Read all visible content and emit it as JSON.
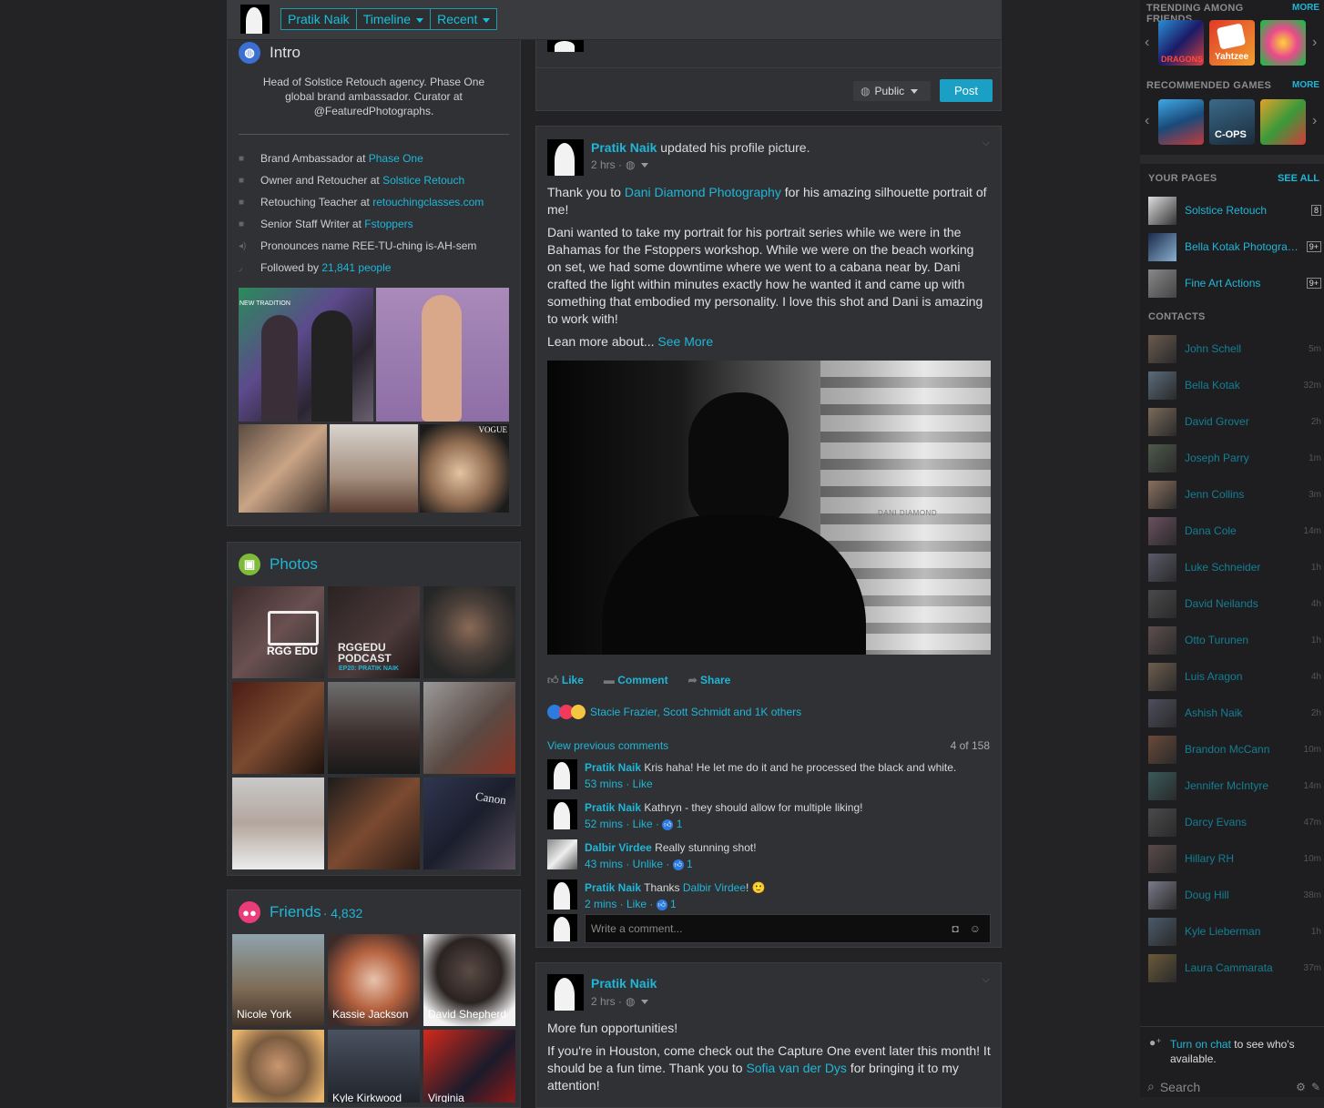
{
  "topbar": {
    "crumb_name": "Pratik Naik",
    "crumb_timeline": "Timeline",
    "crumb_recent": "Recent"
  },
  "intro": {
    "title": "Intro",
    "bio": "Head of Solstice Retouch agency. Phase One global brand ambassador. Curator at @FeaturedPhotographs.",
    "items": [
      {
        "text": "Brand Ambassador at ",
        "link": "Phase One"
      },
      {
        "text": "Owner and Retoucher at ",
        "link": "Solstice Retouch"
      },
      {
        "text": "Retouching Teacher at ",
        "link": "retouchingclasses.com"
      },
      {
        "text": "Senior Staff Writer at ",
        "link": "Fstoppers"
      },
      {
        "text": "Pronounces name REE-TU-ching is-AH-sem",
        "link": ""
      },
      {
        "text": "Followed by ",
        "link": "21,841 people"
      }
    ],
    "featured_label_1": "NEW TRADITION",
    "featured_label_2": "VOGUE"
  },
  "photos": {
    "title": "Photos",
    "tile1_text": "RGG EDU",
    "tile2_line1": "RGGEDU",
    "tile2_line2": "PODCAST",
    "tile2_line3": "EP20: PRATIK NAIK",
    "tile9_text": "Canon"
  },
  "friends": {
    "title": "Friends",
    "count": "· 4,832",
    "list": [
      "Nicole York",
      "Kassie Jackson",
      "David Shepherd",
      "",
      "Kyle Kirkwood",
      "Virginia"
    ]
  },
  "composer": {
    "privacy": "Public",
    "post_label": "Post"
  },
  "post1": {
    "author": "Pratik Naik",
    "action": " updated his profile picture.",
    "time": "2 hrs ·",
    "para1_pre": "Thank you to ",
    "para1_link": "Dani Diamond Photography",
    "para1_post": " for his amazing silhouette portrait of me!",
    "para2": "Dani wanted to take my portrait for his portrait series while we were in the Bahamas for the Fstoppers workshop. While we were on the beach working on set, we had some downtime where we went to a cabana near by. Dani crafted the light within minutes exactly how he wanted it and came up with something that embodied my personality. I love this shot and Dani is amazing to work with!",
    "para3_pre": "Lean more about... ",
    "para3_link": "See More",
    "watermark": "DANI DIAMOND",
    "like": "Like",
    "comment": "Comment",
    "share": "Share",
    "reactions": "Stacie Frazier, Scott Schmidt and 1K others",
    "view_prev": "View previous comments",
    "count": "4 of 158",
    "comments": [
      {
        "name": "Pratik Naik",
        "text": " Kris haha! He let me do it and he processed the black and white.",
        "meta": "53 mins · Like",
        "likes": ""
      },
      {
        "name": "Pratik Naik",
        "text": " Kathryn - they should allow for multiple liking!",
        "meta": "52 mins · Like · ",
        "likes": "1"
      },
      {
        "name": "Dalbir Virdee",
        "text": " Really stunning shot!",
        "meta": "43 mins · Unlike · ",
        "likes": "1"
      },
      {
        "name": "Pratik Naik",
        "text": " Thanks ",
        "mention": "Dalbir Virdee",
        "text2": "! 🙂",
        "meta": "2 mins · Like · ",
        "likes": "1"
      }
    ],
    "write_placeholder": "Write a comment..."
  },
  "post2": {
    "author": "Pratik Naik",
    "time": "2 hrs ·",
    "para1": "More fun opportunities!",
    "para2_pre": "If you're in Houston, come check out the Capture One event later this month! It should be a fun time. Thank you to ",
    "para2_link": "Sofia van der Dys",
    "para2_post": " for bringing it to my attention!"
  },
  "right": {
    "trending_title": "TRENDING AMONG FRIENDS",
    "trending_more": "MORE",
    "trending_game1": "DRAGONS",
    "trending_game2": "Yahtzee",
    "recommended_title": "RECOMMENDED GAMES",
    "recommended_more": "MORE",
    "recommended_game2": "C-OPS",
    "your_pages": "YOUR PAGES",
    "see_all": "SEE ALL",
    "pages": [
      {
        "name": "Solstice Retouch",
        "badge": "8"
      },
      {
        "name": "Bella Kotak Photography",
        "badge": "9+"
      },
      {
        "name": "Fine Art Actions",
        "badge": "9+"
      }
    ],
    "contacts_title": "CONTACTS",
    "contacts": [
      {
        "name": "John Schell",
        "time": "5m"
      },
      {
        "name": "Bella Kotak",
        "time": "32m"
      },
      {
        "name": "David Grover",
        "time": "2h"
      },
      {
        "name": "Joseph Parry",
        "time": "1m"
      },
      {
        "name": "Jenn Collins",
        "time": "3m"
      },
      {
        "name": "Dana Cole",
        "time": "14m"
      },
      {
        "name": "Luke Schneider",
        "time": "1h"
      },
      {
        "name": "David Neilands",
        "time": "4h"
      },
      {
        "name": "Otto Turunen",
        "time": "1h"
      },
      {
        "name": "Luis Aragon",
        "time": "4h"
      },
      {
        "name": "Ashish Naik",
        "time": "2h"
      },
      {
        "name": "Brandon McCann",
        "time": "10m"
      },
      {
        "name": "Jennifer McIntyre",
        "time": "14m"
      },
      {
        "name": "Darcy Evans",
        "time": "47m"
      },
      {
        "name": "Hillary RH",
        "time": "10m"
      },
      {
        "name": "Doug Hill",
        "time": "38m"
      },
      {
        "name": "Kyle Lieberman",
        "time": "1h"
      },
      {
        "name": "Laura Cammarata",
        "time": "37m"
      }
    ],
    "chat_link": "Turn on chat",
    "chat_text": " to see who's available.",
    "search_placeholder": "Search"
  }
}
